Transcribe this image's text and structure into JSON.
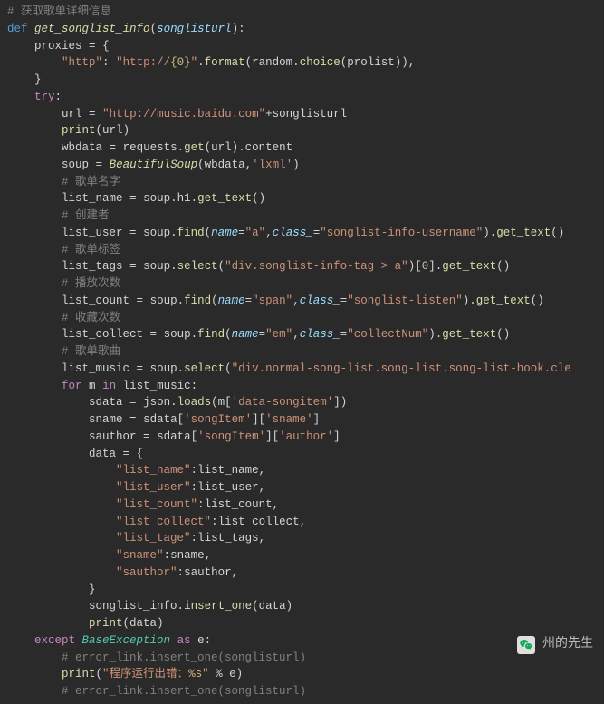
{
  "code": {
    "c1": "# 获取歌单详细信息",
    "def": "def",
    "fn": "get_songlist_info",
    "param": "songlisturl",
    "proxies": "proxies",
    "http_key": "\"http\"",
    "http_val1": "\"http://",
    "http_pl": "{0}",
    "http_val2": "\"",
    "format": "format",
    "random": "random",
    "choice": "choice",
    "prolist": "prolist",
    "try": "try",
    "url": "url",
    "url_str": "\"http://music.baidu.com\"",
    "songlisturl": "songlisturl",
    "print": "print",
    "wbdata": "wbdata",
    "requests": "requests",
    "get": "get",
    "content": "content",
    "soup": "soup",
    "bs": "BeautifulSoup",
    "lxml": "'lxml'",
    "c2": "# 歌单名字",
    "list_name": "list_name",
    "h1": "h1",
    "get_text": "get_text",
    "c3": "# 创建者",
    "list_user": "list_user",
    "find": "find",
    "name_kw": "name",
    "a_str": "\"a\"",
    "class_kw": "class_",
    "cls_user": "\"songlist-info-username\"",
    "c4": "# 歌单标签",
    "list_tags": "list_tags",
    "select": "select",
    "sel_tag": "\"div.songlist-info-tag > a\"",
    "zero": "0",
    "c5": "# 播放次数",
    "list_count": "list_count",
    "span_str": "\"span\"",
    "cls_listen": "\"songlist-listen\"",
    "c6": "# 收藏次数",
    "list_collect": "list_collect",
    "em_str": "\"em\"",
    "cls_collect": "\"collectNum\"",
    "c7": "# 歌单歌曲",
    "list_music": "list_music",
    "sel_music": "\"div.normal-song-list.song-list.song-list-hook.cle",
    "for": "for",
    "m": "m",
    "in": "in",
    "sdata": "sdata",
    "json": "json",
    "loads": "loads",
    "dsi": "'data-songitem'",
    "sname": "sname",
    "si": "'songItem'",
    "sn": "'sname'",
    "sauthor": "sauthor",
    "au": "'author'",
    "data": "data",
    "k_ln": "\"list_name\"",
    "k_lu": "\"list_user\"",
    "k_lc": "\"list_count\"",
    "k_lco": "\"list_collect\"",
    "k_lt": "\"list_tage\"",
    "k_sn": "\"sname\"",
    "k_sa": "\"sauthor\"",
    "sli": "songlist_info",
    "insert_one": "insert_one",
    "except": "except",
    "baseexc": "BaseException",
    "as": "as",
    "e": "e",
    "c8": "# error_link.insert_one(songlisturl)",
    "err1": "\"程序运行出错：",
    "pct": "%s",
    "err2": "\"",
    "c9": "# error_link.insert_one(songlisturl)"
  },
  "watermark": {
    "text": "州的先生"
  }
}
